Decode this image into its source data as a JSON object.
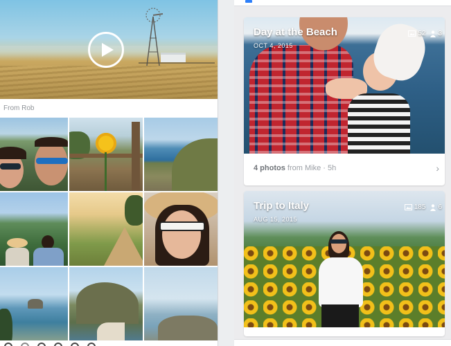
{
  "left_pane": {
    "from_label": "From Rob"
  },
  "cards": [
    {
      "title": "Day at the Beach",
      "date": "OCT 4, 2015",
      "photo_count": "52",
      "people_count": "3",
      "meta_count": "4 photos",
      "meta_rest": " from Mike · 5h"
    },
    {
      "title": "Trip to Italy",
      "date": "AUG 15, 2015",
      "photo_count": "185",
      "people_count": "6",
      "meta_count": "",
      "meta_rest": ""
    }
  ],
  "icons": {
    "play": "play-icon",
    "photos": "image-icon",
    "people": "person-icon",
    "chevron": "chevron-right-icon"
  }
}
